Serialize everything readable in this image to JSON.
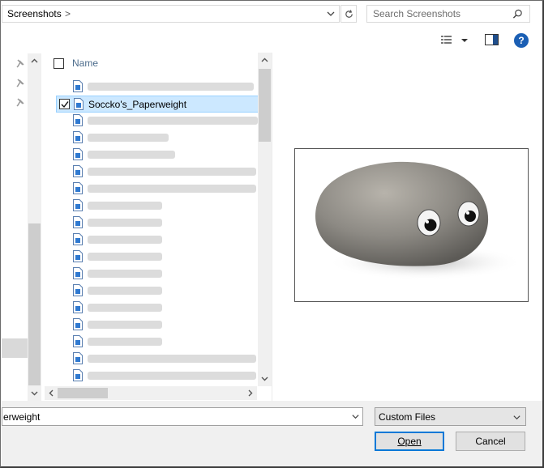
{
  "address": {
    "breadcrumb": "Screenshots",
    "separator": ">"
  },
  "search": {
    "placeholder": "Search Screenshots"
  },
  "toolbar": {
    "help_label": "?"
  },
  "list": {
    "column_name": "Name",
    "selected_file": "Soccko's_Paperweight"
  },
  "bottom": {
    "file_name_value": "erweight",
    "file_type": "Custom Files",
    "open_label": "Open",
    "cancel_label": "Cancel"
  },
  "colors": {
    "selection_bg": "#cce8ff",
    "accent": "#0078d7",
    "help_bg": "#1b5fb4",
    "header_text": "#4c6c8c"
  },
  "icons": [
    "chevron-down-icon",
    "refresh-icon",
    "search-icon",
    "view-options-icon",
    "preview-pane-icon",
    "help-icon",
    "pin-icon",
    "image-file-icon",
    "check-icon"
  ]
}
